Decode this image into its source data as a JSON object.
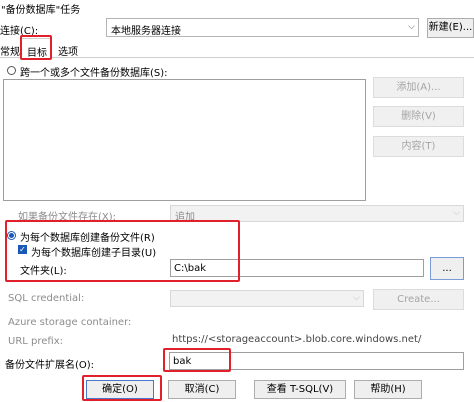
{
  "window": {
    "title": "\"备份数据库\"任务"
  },
  "connection": {
    "label": "连接(C):",
    "value": "本地服务器连接",
    "new_button": "新建(E)..."
  },
  "tabs": [
    {
      "label": "常规"
    },
    {
      "label": "目标"
    },
    {
      "label": "选项"
    }
  ],
  "span_files": {
    "label": "跨一个或多个文件备份数据库(S):"
  },
  "list_buttons": {
    "add": "添加(A)...",
    "remove": "删除(V)",
    "contents": "内容(T)"
  },
  "if_exists": {
    "label": "如果备份文件存在(X):",
    "value": "追加"
  },
  "per_db": {
    "radio_label": "为每个数据库创建备份文件(R)",
    "subdir_label": "为每个数据库创建子目录(U)",
    "folder_label": "文件夹(L):",
    "folder_value": "C:\\bak",
    "browse_label": "..."
  },
  "sql_credential": {
    "label": "SQL credential:",
    "create_label": "Create..."
  },
  "azure": {
    "label": "Azure storage container:"
  },
  "url_prefix": {
    "label": "URL prefix:",
    "value": "https://<storageaccount>.blob.core.windows.net/"
  },
  "extension": {
    "label": "备份文件扩展名(O):",
    "value": "bak"
  },
  "footer": {
    "ok": "确定(O)",
    "cancel": "取消(C)",
    "view_tsql": "查看 T-SQL(V)",
    "help": "帮助(H)"
  },
  "colors": {
    "highlight_border": "#e0202a",
    "accent": "#1a58b8"
  },
  "icons": {
    "dropdown": "chevron-down-icon",
    "checkbox": "check-icon"
  }
}
